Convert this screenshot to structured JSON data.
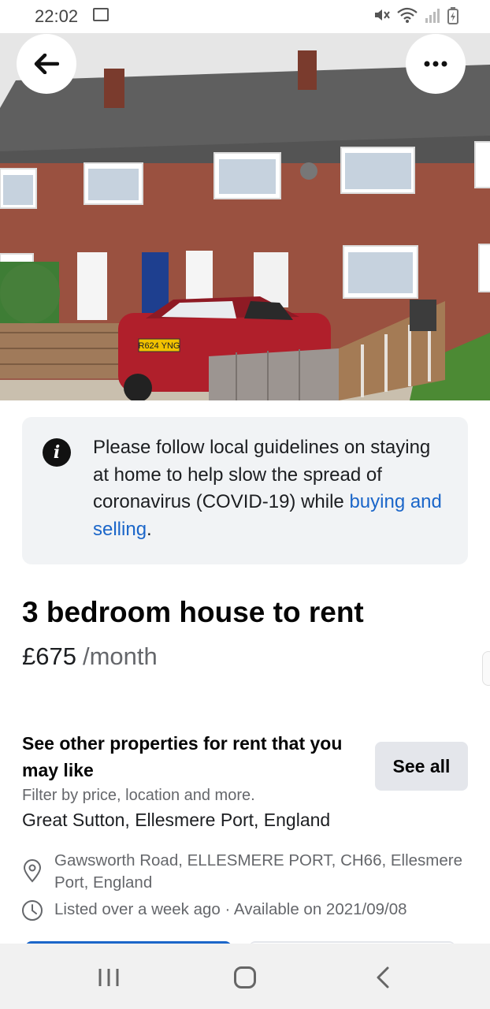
{
  "status_bar": {
    "time": "22:02"
  },
  "notice": {
    "text": "Please follow local guidelines on staying at home to help slow the spread of coronavirus (COVID-19) while ",
    "link": "buying and selling",
    "end": "."
  },
  "listing": {
    "title": "3 bedroom house to rent",
    "price": "£675",
    "price_unit": "/month"
  },
  "recommendations": {
    "title": "See other properties for rent that you may like",
    "subtitle": "Filter by price, location and more.",
    "location": "Great Sutton, Ellesmere Port, England",
    "see_all_label": "See all"
  },
  "details": {
    "address": "Gawsworth Road, ELLESMERE PORT, CH66, Ellesmere Port, England",
    "listed": "Listed over a week ago · Available on 2021/09/08"
  },
  "photo": {
    "number_plate": "R624 YNG"
  },
  "icons": {
    "back": "arrow-left-icon",
    "more": "more-dots-icon",
    "info": "info-icon",
    "location": "location-pin-icon",
    "time": "clock-icon"
  },
  "colors": {
    "link": "#1b66c9",
    "notice_bg": "#f1f3f5",
    "button_bg": "#e4e6eb"
  }
}
